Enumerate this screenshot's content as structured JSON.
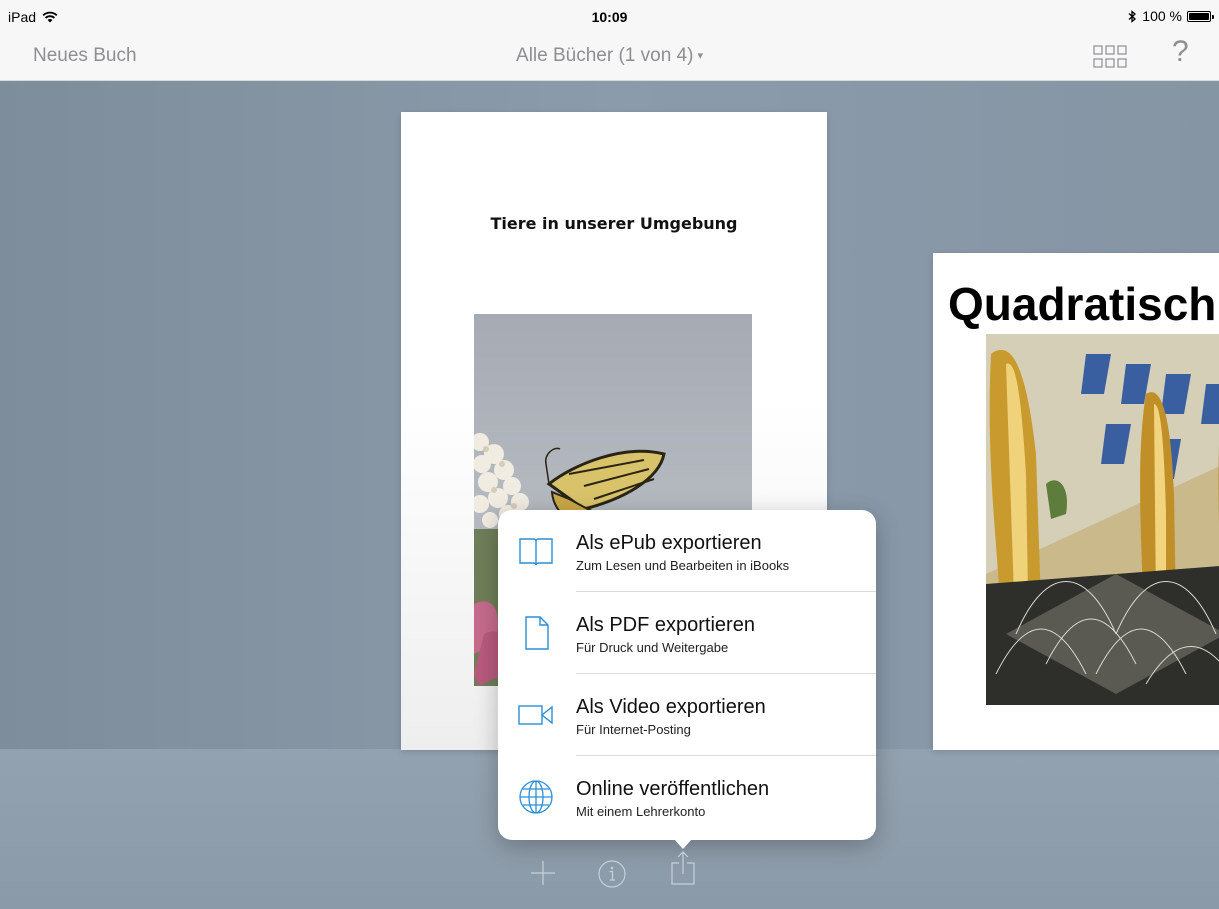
{
  "status_bar": {
    "device": "iPad",
    "time": "10:09",
    "battery": "100 %"
  },
  "nav_bar": {
    "left_button": "Neues Buch",
    "title": "Alle Bücher (1 von 4)",
    "title_caret": "▾",
    "right_help": "?"
  },
  "books": [
    {
      "title": "Tiere in unserer Umgebung"
    },
    {
      "title": "Quadratisch"
    }
  ],
  "export_menu": {
    "items": [
      {
        "label": "Als ePub exportieren",
        "subtitle": "Zum Lesen und Bearbeiten in iBooks",
        "icon": "book-icon"
      },
      {
        "label": "Als PDF exportieren",
        "subtitle": "Für Druck und Weitergabe",
        "icon": "document-icon"
      },
      {
        "label": "Als Video exportieren",
        "subtitle": "Für Internet-Posting",
        "icon": "video-camera-icon"
      },
      {
        "label": "Online veröffentlichen",
        "subtitle": "Mit einem Lehrerkonto",
        "icon": "globe-icon"
      }
    ]
  },
  "toolbar": {
    "add_icon": "plus-icon",
    "info_icon": "info-icon",
    "share_icon": "share-icon"
  },
  "colors": {
    "accent": "#2a8fd6",
    "nav_text": "#8e8e93",
    "background": "#8a9aa8"
  }
}
